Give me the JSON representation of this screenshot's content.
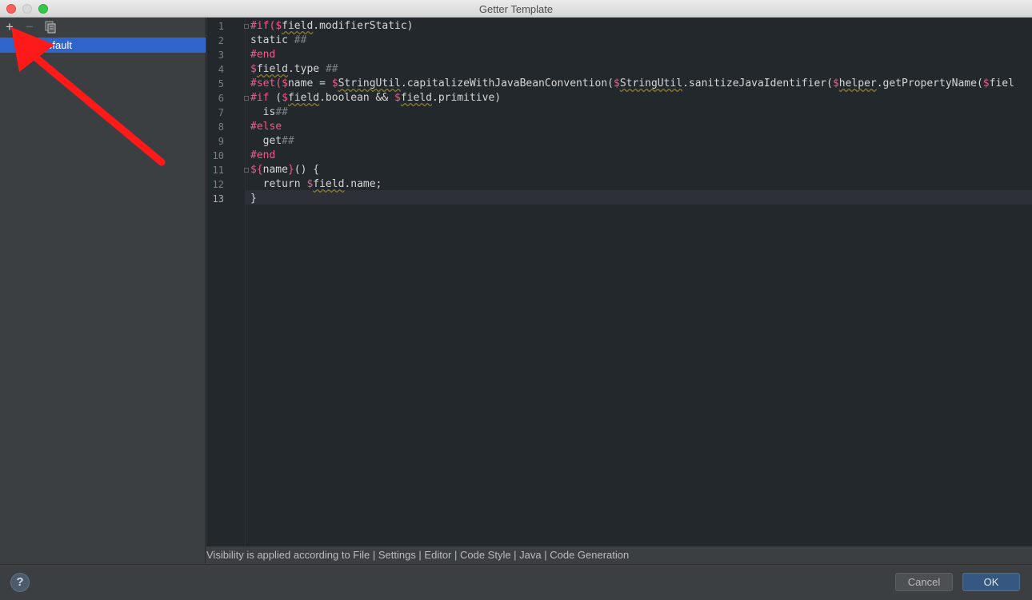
{
  "window": {
    "title": "Getter Template"
  },
  "toolbar": {
    "add_label": "+",
    "remove_label": "−"
  },
  "templates": {
    "selected": "IntelliJ Default",
    "visible_label": "lliJ Default"
  },
  "editor": {
    "line_numbers": [
      "1",
      "2",
      "3",
      "4",
      "5",
      "6",
      "7",
      "8",
      "9",
      "10",
      "11",
      "12",
      "13"
    ],
    "current_line": "13"
  },
  "hint": "Visibility is applied according to File | Settings | Editor | Code Style | Java | Code Generation",
  "buttons": {
    "help": "?",
    "cancel": "Cancel",
    "ok": "OK"
  },
  "colors": {
    "selection": "#2f65ca",
    "editor_bg": "#23282c",
    "keyword": "#ee5b8a",
    "annotation_arrow": "#ff1a1a"
  },
  "icons": [
    "add-icon",
    "remove-icon",
    "copy-icon",
    "help-icon",
    "fold-marker-icon"
  ]
}
